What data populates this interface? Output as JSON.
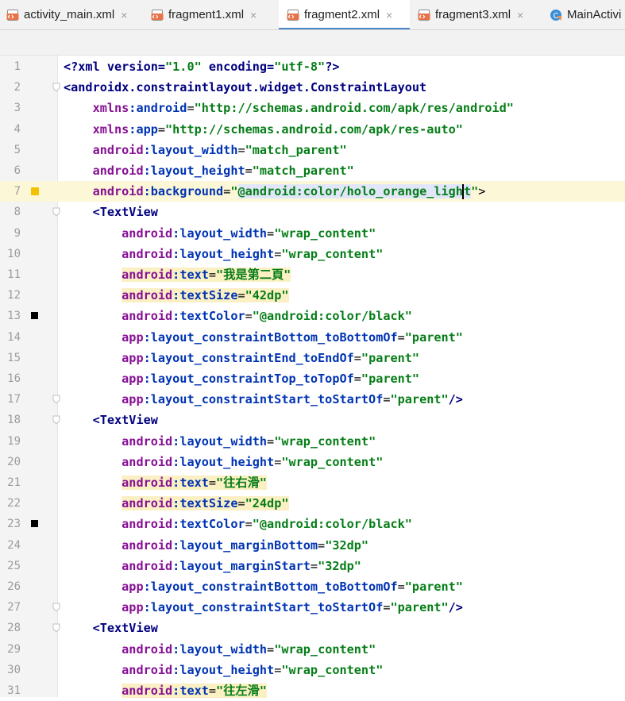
{
  "tabs": [
    {
      "label": "activity_main.xml",
      "close": "×",
      "icon": "xml-file-icon",
      "active": false
    },
    {
      "label": "fragment1.xml",
      "close": "×",
      "icon": "xml-file-icon",
      "active": false
    },
    {
      "label": "fragment2.xml",
      "close": "×",
      "icon": "xml-file-icon",
      "active": true
    },
    {
      "label": "fragment3.xml",
      "close": "×",
      "icon": "xml-file-icon",
      "active": false
    },
    {
      "label": "MainActivi",
      "close": "",
      "icon": "kotlin-class-icon",
      "active": false
    }
  ],
  "colors": {
    "current_line": "#fcf7d6",
    "highlight": "#fbf0c4",
    "tag": "#000080",
    "attr_ns": "#871094",
    "attr_name": "#0033b3",
    "string": "#067d17",
    "gutter_color_marker": "#f2c200"
  },
  "editor": {
    "current_line": 7,
    "lines": [
      {
        "n": "1",
        "tokens": [
          [
            "t-decl",
            "<?xml version="
          ],
          [
            "t-str",
            "\"1.0\""
          ],
          [
            "t-decl",
            " encoding="
          ],
          [
            "t-str",
            "\"utf-8\""
          ],
          [
            "t-decl",
            "?>"
          ]
        ]
      },
      {
        "n": "2",
        "fold": true,
        "tokens": [
          [
            "t-tag",
            "<androidx.constraintlayout.widget.ConstraintLayout"
          ]
        ]
      },
      {
        "n": "3",
        "tokens": [
          [
            "t-pun",
            "    "
          ],
          [
            "t-ns",
            "xmlns"
          ],
          [
            "t-attr",
            ":android"
          ],
          [
            "t-pun",
            "="
          ],
          [
            "t-str",
            "\"http://schemas.android.com/apk/res/android\""
          ]
        ]
      },
      {
        "n": "4",
        "tokens": [
          [
            "t-pun",
            "    "
          ],
          [
            "t-ns",
            "xmlns"
          ],
          [
            "t-attr",
            ":app"
          ],
          [
            "t-pun",
            "="
          ],
          [
            "t-str",
            "\"http://schemas.android.com/apk/res-auto\""
          ]
        ]
      },
      {
        "n": "5",
        "tokens": [
          [
            "t-pun",
            "    "
          ],
          [
            "t-ns",
            "android"
          ],
          [
            "t-attr",
            ":layout_width"
          ],
          [
            "t-pun",
            "="
          ],
          [
            "t-str",
            "\"match_parent\""
          ]
        ]
      },
      {
        "n": "6",
        "tokens": [
          [
            "t-pun",
            "    "
          ],
          [
            "t-ns",
            "android"
          ],
          [
            "t-attr",
            ":layout_height"
          ],
          [
            "t-pun",
            "="
          ],
          [
            "t-str",
            "\"match_parent\""
          ]
        ]
      },
      {
        "n": "7",
        "marker": "yellow",
        "tokens": [
          [
            "t-pun",
            "    "
          ],
          [
            "t-ns",
            "android"
          ],
          [
            "t-attr",
            ":background"
          ],
          [
            "t-pun",
            "="
          ],
          [
            "t-str",
            "\""
          ],
          [
            "t-str sel",
            "@android:color/holo_orange_ligh"
          ],
          [
            "caret",
            ""
          ],
          [
            "t-str sel",
            "t"
          ],
          [
            "t-str",
            "\""
          ],
          [
            "t-pun",
            ">"
          ]
        ]
      },
      {
        "n": "8",
        "fold": true,
        "tokens": [
          [
            "t-pun",
            "    "
          ],
          [
            "t-tag",
            "<TextView"
          ]
        ]
      },
      {
        "n": "9",
        "tokens": [
          [
            "t-pun",
            "        "
          ],
          [
            "t-ns",
            "android"
          ],
          [
            "t-attr",
            ":layout_width"
          ],
          [
            "t-pun",
            "="
          ],
          [
            "t-str",
            "\"wrap_content\""
          ]
        ]
      },
      {
        "n": "10",
        "tokens": [
          [
            "t-pun",
            "        "
          ],
          [
            "t-ns",
            "android"
          ],
          [
            "t-attr",
            ":layout_height"
          ],
          [
            "t-pun",
            "="
          ],
          [
            "t-str",
            "\"wrap_content\""
          ]
        ]
      },
      {
        "n": "11",
        "tokens": [
          [
            "t-pun",
            "        "
          ],
          [
            "t-ns hl",
            "android"
          ],
          [
            "t-attr hl",
            ":text"
          ],
          [
            "t-pun hl",
            "="
          ],
          [
            "t-str hl",
            "\"我是第二頁\""
          ]
        ]
      },
      {
        "n": "12",
        "tokens": [
          [
            "t-pun",
            "        "
          ],
          [
            "t-ns hl",
            "android"
          ],
          [
            "t-attr hl",
            ":textSize"
          ],
          [
            "t-pun hl",
            "="
          ],
          [
            "t-str hl",
            "\"42dp\""
          ]
        ]
      },
      {
        "n": "13",
        "marker": "black",
        "tokens": [
          [
            "t-pun",
            "        "
          ],
          [
            "t-ns",
            "android"
          ],
          [
            "t-attr",
            ":textColor"
          ],
          [
            "t-pun",
            "="
          ],
          [
            "t-str",
            "\"@android:color/black\""
          ]
        ]
      },
      {
        "n": "14",
        "tokens": [
          [
            "t-pun",
            "        "
          ],
          [
            "t-ns",
            "app"
          ],
          [
            "t-attr",
            ":layout_constraintBottom_toBottomOf"
          ],
          [
            "t-pun",
            "="
          ],
          [
            "t-str",
            "\"parent\""
          ]
        ]
      },
      {
        "n": "15",
        "tokens": [
          [
            "t-pun",
            "        "
          ],
          [
            "t-ns",
            "app"
          ],
          [
            "t-attr",
            ":layout_constraintEnd_toEndOf"
          ],
          [
            "t-pun",
            "="
          ],
          [
            "t-str",
            "\"parent\""
          ]
        ]
      },
      {
        "n": "16",
        "tokens": [
          [
            "t-pun",
            "        "
          ],
          [
            "t-ns",
            "app"
          ],
          [
            "t-attr",
            ":layout_constraintTop_toTopOf"
          ],
          [
            "t-pun",
            "="
          ],
          [
            "t-str",
            "\"parent\""
          ]
        ]
      },
      {
        "n": "17",
        "fold": true,
        "tokens": [
          [
            "t-pun",
            "        "
          ],
          [
            "t-ns",
            "app"
          ],
          [
            "t-attr",
            ":layout_constraintStart_toStartOf"
          ],
          [
            "t-pun",
            "="
          ],
          [
            "t-str",
            "\"parent\""
          ],
          [
            "t-tag",
            "/>"
          ]
        ]
      },
      {
        "n": "18",
        "fold": true,
        "tokens": [
          [
            "t-pun",
            "    "
          ],
          [
            "t-tag",
            "<TextView"
          ]
        ]
      },
      {
        "n": "19",
        "tokens": [
          [
            "t-pun",
            "        "
          ],
          [
            "t-ns",
            "android"
          ],
          [
            "t-attr",
            ":layout_width"
          ],
          [
            "t-pun",
            "="
          ],
          [
            "t-str",
            "\"wrap_content\""
          ]
        ]
      },
      {
        "n": "20",
        "tokens": [
          [
            "t-pun",
            "        "
          ],
          [
            "t-ns",
            "android"
          ],
          [
            "t-attr",
            ":layout_height"
          ],
          [
            "t-pun",
            "="
          ],
          [
            "t-str",
            "\"wrap_content\""
          ]
        ]
      },
      {
        "n": "21",
        "tokens": [
          [
            "t-pun",
            "        "
          ],
          [
            "t-ns hl",
            "android"
          ],
          [
            "t-attr hl",
            ":text"
          ],
          [
            "t-pun hl",
            "="
          ],
          [
            "t-str hl",
            "\"往右滑\""
          ]
        ]
      },
      {
        "n": "22",
        "tokens": [
          [
            "t-pun",
            "        "
          ],
          [
            "t-ns hl",
            "android"
          ],
          [
            "t-attr hl",
            ":textSize"
          ],
          [
            "t-pun hl",
            "="
          ],
          [
            "t-str hl",
            "\"24dp\""
          ]
        ]
      },
      {
        "n": "23",
        "marker": "black",
        "tokens": [
          [
            "t-pun",
            "        "
          ],
          [
            "t-ns",
            "android"
          ],
          [
            "t-attr",
            ":textColor"
          ],
          [
            "t-pun",
            "="
          ],
          [
            "t-str",
            "\"@android:color/black\""
          ]
        ]
      },
      {
        "n": "24",
        "tokens": [
          [
            "t-pun",
            "        "
          ],
          [
            "t-ns",
            "android"
          ],
          [
            "t-attr",
            ":layout_marginBottom"
          ],
          [
            "t-pun",
            "="
          ],
          [
            "t-str",
            "\"32dp\""
          ]
        ]
      },
      {
        "n": "25",
        "tokens": [
          [
            "t-pun",
            "        "
          ],
          [
            "t-ns",
            "android"
          ],
          [
            "t-attr",
            ":layout_marginStart"
          ],
          [
            "t-pun",
            "="
          ],
          [
            "t-str",
            "\"32dp\""
          ]
        ]
      },
      {
        "n": "26",
        "tokens": [
          [
            "t-pun",
            "        "
          ],
          [
            "t-ns",
            "app"
          ],
          [
            "t-attr",
            ":layout_constraintBottom_toBottomOf"
          ],
          [
            "t-pun",
            "="
          ],
          [
            "t-str",
            "\"parent\""
          ]
        ]
      },
      {
        "n": "27",
        "fold": true,
        "tokens": [
          [
            "t-pun",
            "        "
          ],
          [
            "t-ns",
            "app"
          ],
          [
            "t-attr",
            ":layout_constraintStart_toStartOf"
          ],
          [
            "t-pun",
            "="
          ],
          [
            "t-str",
            "\"parent\""
          ],
          [
            "t-tag",
            "/>"
          ]
        ]
      },
      {
        "n": "28",
        "fold": true,
        "tokens": [
          [
            "t-pun",
            "    "
          ],
          [
            "t-tag",
            "<TextView"
          ]
        ]
      },
      {
        "n": "29",
        "tokens": [
          [
            "t-pun",
            "        "
          ],
          [
            "t-ns",
            "android"
          ],
          [
            "t-attr",
            ":layout_width"
          ],
          [
            "t-pun",
            "="
          ],
          [
            "t-str",
            "\"wrap_content\""
          ]
        ]
      },
      {
        "n": "30",
        "tokens": [
          [
            "t-pun",
            "        "
          ],
          [
            "t-ns",
            "android"
          ],
          [
            "t-attr",
            ":layout_height"
          ],
          [
            "t-pun",
            "="
          ],
          [
            "t-str",
            "\"wrap_content\""
          ]
        ]
      },
      {
        "n": "31",
        "tokens": [
          [
            "t-pun",
            "        "
          ],
          [
            "t-ns hl",
            "android"
          ],
          [
            "t-attr hl",
            ":text"
          ],
          [
            "t-pun hl",
            "="
          ],
          [
            "t-str hl",
            "\"往左滑\""
          ]
        ]
      }
    ]
  }
}
